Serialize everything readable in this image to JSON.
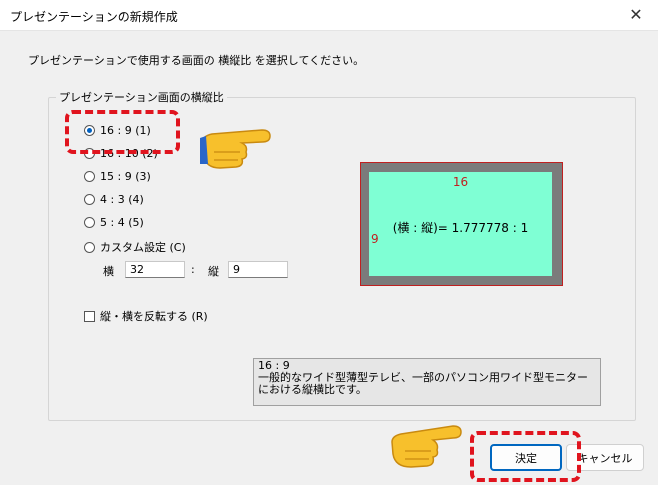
{
  "window": {
    "title": "プレゼンテーションの新規作成",
    "close_glyph": "✕"
  },
  "instruction": "プレゼンテーションで使用する画面の 横縦比 を選択してください。",
  "group": {
    "label": "プレゼンテーション画面の横縦比",
    "options": [
      {
        "label": "16 : 9 (1)",
        "selected": true
      },
      {
        "label": "16 : 10 (2)",
        "selected": false
      },
      {
        "label": "15 : 9 (3)",
        "selected": false
      },
      {
        "label": "4 : 3 (4)",
        "selected": false
      },
      {
        "label": "5 : 4 (5)",
        "selected": false
      },
      {
        "label": "カスタム設定 (C)",
        "selected": false
      }
    ],
    "custom": {
      "width_label": "横",
      "width_value": "32",
      "separator": ":",
      "height_label": "縦",
      "height_value": "9"
    },
    "swap_checkbox": {
      "label": "縦・横を反転する (R)",
      "checked": false
    }
  },
  "preview": {
    "width_text": "16",
    "height_text": "9",
    "ratio_text": "(横 : 縦)= 1.777778 : 1"
  },
  "description": {
    "line1": "16 : 9",
    "line2": "一般的なワイド型薄型テレビ、一部のパソコン用ワイド型モニターにおける縦横比です。"
  },
  "buttons": {
    "ok": "決定",
    "cancel": "キャンセル"
  },
  "colors": {
    "highlight": "#e0141e",
    "preview_bg": "#7fffd4",
    "preview_frame": "#7b7b7b",
    "accent": "#0067c0"
  },
  "icons": [
    "pointing-hand-icon",
    "pointing-hand-icon"
  ]
}
